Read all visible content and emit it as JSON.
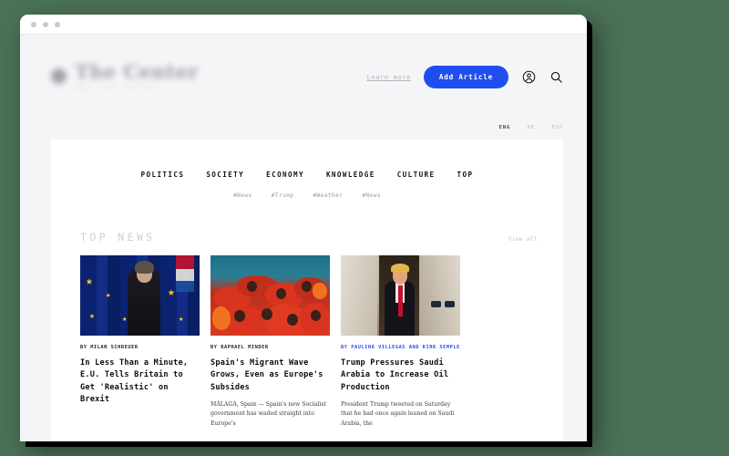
{
  "window": {
    "dots": [
      "dot-red",
      "dot-yellow",
      "dot-green"
    ]
  },
  "header": {
    "brand_name": "The Center",
    "brand_tagline": "NEWS THAT MATTERS",
    "learn_more": "Learn more",
    "add_article": "Add Article",
    "account_icon": "user-circle-icon",
    "search_icon": "search-icon",
    "languages": [
      {
        "code": "ENG",
        "active": true
      },
      {
        "code": "DE",
        "active": false
      },
      {
        "code": "ESP",
        "active": false
      }
    ],
    "lang_separator": "|"
  },
  "nav": {
    "items": [
      {
        "label": "POLITICS"
      },
      {
        "label": "SOCIETY"
      },
      {
        "label": "ECONOMY"
      },
      {
        "label": "KNOWLEDGE"
      },
      {
        "label": "CULTURE"
      },
      {
        "label": "TOP"
      }
    ],
    "tags": [
      {
        "label": "#News"
      },
      {
        "label": "#Trump"
      },
      {
        "label": "#Weather"
      },
      {
        "label": "#News"
      }
    ]
  },
  "section": {
    "title": "TOP NEWS",
    "view_all": "View all"
  },
  "articles": [
    {
      "byline": "BY MILAN SCHREUER",
      "byline_accent": false,
      "headline": "In Less Than a Minute, E.U. Tells Britain to Get 'Realistic' on Brexit",
      "excerpt": "",
      "image_alt": "theresa-may-eu-flags-photo"
    },
    {
      "byline": "BY RAPHAEL MINDER",
      "byline_accent": false,
      "headline": "Spain's Migrant Wave Grows, Even as Europe's Subsides",
      "excerpt": "MÁLAGA, Spain — Spain's new Socialist government has waded straight into Europe's",
      "image_alt": "migrants-red-life-vests-boat-photo"
    },
    {
      "byline": "BY PAULINA VILLEGAS AND KIRK SEMPLE",
      "byline_accent": true,
      "headline": "Trump Pressures Saudi Arabia to Increase Oil Production",
      "excerpt": "President Trump tweeted on Saturday that he had once again leaned on Saudi Arabia, the",
      "image_alt": "trump-aircraft-doorway-photo"
    }
  ],
  "colors": {
    "accent_blue": "#1f4ef0",
    "page_background": "#4a7055",
    "card_background": "#ffffff",
    "viewport_background": "#f4f5f7"
  }
}
